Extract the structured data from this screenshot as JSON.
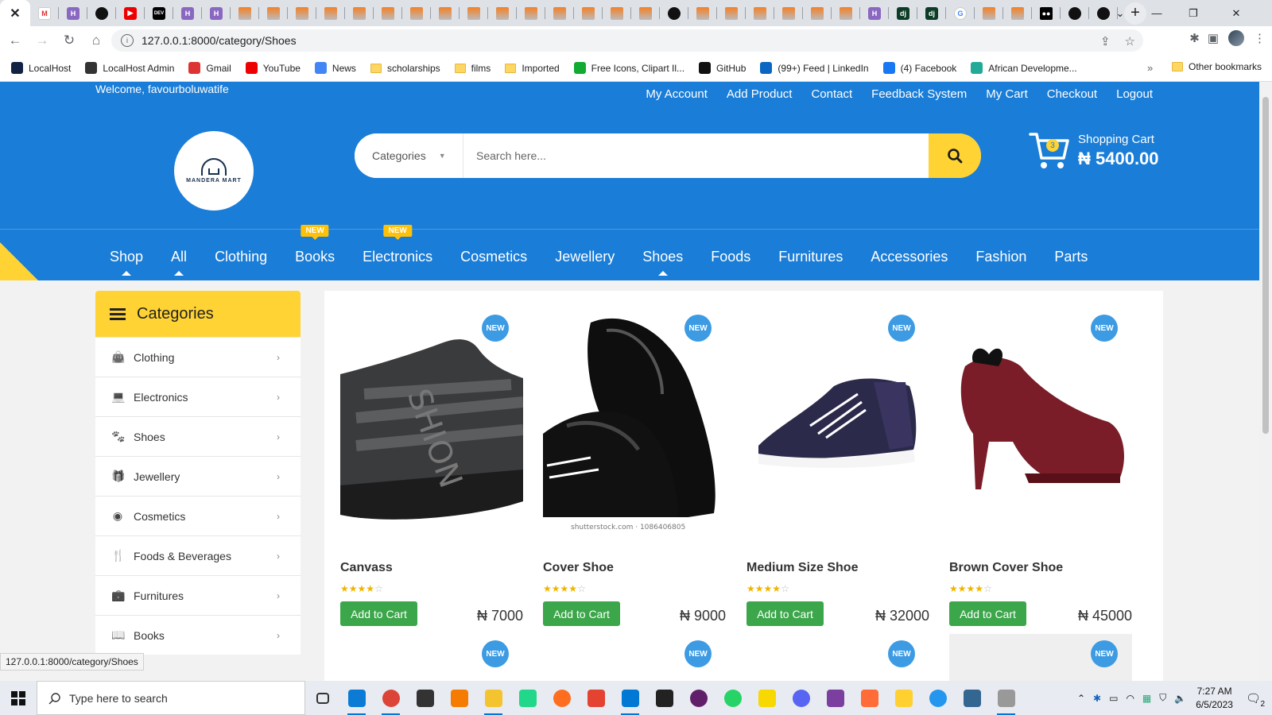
{
  "browser": {
    "url": "127.0.0.1:8000/category/Shoes",
    "tabs": [
      {
        "icon": "gmail-icon",
        "cls": "gm",
        "glyph": "M"
      },
      {
        "icon": "hashnode-icon",
        "cls": "hl",
        "glyph": "H"
      },
      {
        "icon": "github-icon",
        "cls": "gh",
        "glyph": ""
      },
      {
        "icon": "youtube-icon",
        "cls": "yt",
        "glyph": "▶"
      },
      {
        "icon": "dev-icon",
        "cls": "dev",
        "glyph": "DEV"
      },
      {
        "icon": "hashnode-icon",
        "cls": "hl",
        "glyph": "H"
      },
      {
        "icon": "hashnode-icon",
        "cls": "hl",
        "glyph": "H"
      },
      {
        "icon": "stackoverflow-icon",
        "cls": "so",
        "glyph": ""
      },
      {
        "icon": "stackoverflow-icon",
        "cls": "so",
        "glyph": ""
      },
      {
        "icon": "stackoverflow-icon",
        "cls": "so",
        "glyph": ""
      },
      {
        "icon": "stackoverflow-icon",
        "cls": "so",
        "glyph": ""
      },
      {
        "icon": "stackoverflow-icon",
        "cls": "so",
        "glyph": ""
      },
      {
        "icon": "stackoverflow-icon",
        "cls": "so",
        "glyph": ""
      },
      {
        "icon": "stackoverflow-icon",
        "cls": "so",
        "glyph": ""
      },
      {
        "icon": "stackoverflow-icon",
        "cls": "so",
        "glyph": ""
      },
      {
        "icon": "stackoverflow-icon",
        "cls": "so",
        "glyph": ""
      },
      {
        "icon": "stackoverflow-icon",
        "cls": "so",
        "glyph": ""
      },
      {
        "icon": "stackoverflow-icon",
        "cls": "so",
        "glyph": ""
      },
      {
        "icon": "stackoverflow-icon",
        "cls": "so",
        "glyph": ""
      },
      {
        "icon": "stackoverflow-icon",
        "cls": "so",
        "glyph": ""
      },
      {
        "icon": "stackoverflow-icon",
        "cls": "so",
        "glyph": ""
      },
      {
        "icon": "stackoverflow-icon",
        "cls": "so",
        "glyph": ""
      },
      {
        "icon": "github-icon",
        "cls": "gh",
        "glyph": ""
      },
      {
        "icon": "stackoverflow-icon",
        "cls": "so",
        "glyph": ""
      },
      {
        "icon": "stackoverflow-icon",
        "cls": "so",
        "glyph": ""
      },
      {
        "icon": "stackoverflow-icon",
        "cls": "so",
        "glyph": ""
      },
      {
        "icon": "stackoverflow-icon",
        "cls": "so",
        "glyph": ""
      },
      {
        "icon": "stackoverflow-icon",
        "cls": "so",
        "glyph": ""
      },
      {
        "icon": "stackoverflow-icon",
        "cls": "so",
        "glyph": ""
      },
      {
        "icon": "hashnode-icon",
        "cls": "hl",
        "glyph": "H"
      },
      {
        "icon": "django-icon",
        "cls": "dj",
        "glyph": "dj"
      },
      {
        "icon": "django-icon",
        "cls": "dj",
        "glyph": "dj"
      },
      {
        "icon": "google-icon",
        "cls": "gg",
        "glyph": "G"
      },
      {
        "icon": "stackoverflow-icon",
        "cls": "so",
        "glyph": ""
      },
      {
        "icon": "stackoverflow-icon",
        "cls": "so",
        "glyph": ""
      },
      {
        "icon": "medium-icon",
        "cls": "md",
        "glyph": "●●"
      },
      {
        "icon": "github-icon",
        "cls": "gh",
        "glyph": ""
      },
      {
        "icon": "github-icon",
        "cls": "gh",
        "glyph": ""
      }
    ],
    "bookmarks": [
      {
        "label": "LocalHost",
        "icon": "localhost-icon",
        "color": "#124"
      },
      {
        "label": "LocalHost Admin",
        "icon": "admin-icon",
        "color": "#333"
      },
      {
        "label": "Gmail",
        "icon": "gmail-icon",
        "color": "#d33"
      },
      {
        "label": "YouTube",
        "icon": "youtube-icon",
        "color": "#e00"
      },
      {
        "label": "News",
        "icon": "news-icon",
        "color": "#4285f4"
      },
      {
        "label": "scholarships",
        "icon": "folder-icon",
        "color": "folder"
      },
      {
        "label": "films",
        "icon": "folder-icon",
        "color": "folder"
      },
      {
        "label": "Imported",
        "icon": "folder-icon",
        "color": "folder"
      },
      {
        "label": "Free Icons, Clipart Il...",
        "icon": "flaticon-icon",
        "color": "#1a3"
      },
      {
        "label": "GitHub",
        "icon": "github-icon",
        "color": "#111"
      },
      {
        "label": "(99+) Feed | LinkedIn",
        "icon": "linkedin-icon",
        "color": "#0a66c2"
      },
      {
        "label": "(4) Facebook",
        "icon": "facebook-icon",
        "color": "#1877f2"
      },
      {
        "label": "African Developme...",
        "icon": "afdb-icon",
        "color": "#2a9"
      }
    ],
    "more_bookmarks": "»",
    "other_bookmarks": "Other bookmarks",
    "status_url": "127.0.0.1:8000/category/Shoes"
  },
  "site": {
    "welcome": "Welcome, favourboluwatife",
    "top_links": [
      "My Account",
      "Add Product",
      "Contact",
      "Feedback System",
      "My Cart",
      "Checkout",
      "Logout"
    ],
    "brand": "MANDERA MART",
    "search": {
      "category_label": "Categories",
      "placeholder": "Search here..."
    },
    "cart": {
      "count": "3",
      "label": "Shopping Cart",
      "amount": "₦ 5400.00"
    },
    "nav": [
      {
        "label": "Shop",
        "badge": "",
        "active": true
      },
      {
        "label": "All",
        "badge": "",
        "active": true
      },
      {
        "label": "Clothing",
        "badge": "",
        "active": false
      },
      {
        "label": "Books",
        "badge": "NEW",
        "active": false
      },
      {
        "label": "Electronics",
        "badge": "NEW",
        "active": false
      },
      {
        "label": "Cosmetics",
        "badge": "",
        "active": false
      },
      {
        "label": "Jewellery",
        "badge": "",
        "active": false
      },
      {
        "label": "Shoes",
        "badge": "",
        "active": true
      },
      {
        "label": "Foods",
        "badge": "",
        "active": false
      },
      {
        "label": "Furnitures",
        "badge": "",
        "active": false
      },
      {
        "label": "Accessories",
        "badge": "",
        "active": false
      },
      {
        "label": "Fashion",
        "badge": "",
        "active": false
      },
      {
        "label": "Parts",
        "badge": "",
        "active": false
      }
    ],
    "sidebar": {
      "title": "Categories",
      "items": [
        {
          "label": "Clothing",
          "icon": "shopping-bag-icon",
          "glyph": "👜"
        },
        {
          "label": "Electronics",
          "icon": "laptop-icon",
          "glyph": "💻"
        },
        {
          "label": "Shoes",
          "icon": "paw-icon",
          "glyph": "🐾"
        },
        {
          "label": "Jewellery",
          "icon": "gift-icon",
          "glyph": "🎁"
        },
        {
          "label": "Cosmetics",
          "icon": "eye-slash-icon",
          "glyph": "◉"
        },
        {
          "label": "Foods & Beverages",
          "icon": "utensils-icon",
          "glyph": "🍴"
        },
        {
          "label": "Furnitures",
          "icon": "briefcase-icon",
          "glyph": "💼"
        },
        {
          "label": "Books",
          "icon": "book-icon",
          "glyph": "📖"
        }
      ]
    },
    "new_label": "NEW",
    "add_to_cart": "Add to Cart",
    "products": [
      {
        "name": "Canvass",
        "price": "₦ 7000",
        "rating": 4
      },
      {
        "name": "Cover Shoe",
        "price": "₦ 9000",
        "rating": 4
      },
      {
        "name": "Medium Size Shoe",
        "price": "₦ 32000",
        "rating": 4
      },
      {
        "name": "Brown Cover Shoe",
        "price": "₦ 45000",
        "rating": 4
      }
    ],
    "watermark": "shutterstock.com · 1086406805"
  },
  "taskbar": {
    "search_placeholder": "Type here to search",
    "time": "7:27 AM",
    "date": "6/5/2023",
    "notifications": "2"
  }
}
